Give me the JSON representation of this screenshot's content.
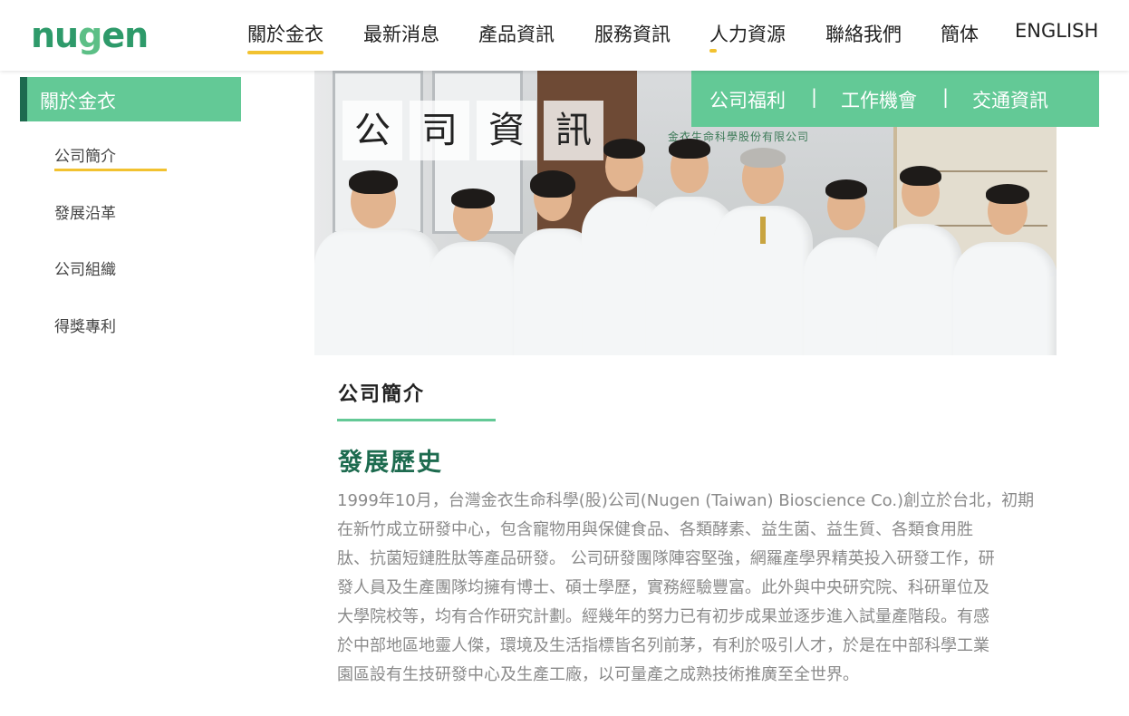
{
  "header": {
    "logo": {
      "part1": "nu",
      "part2": "g",
      "part3": "en"
    },
    "nav": [
      {
        "label": "關於金衣"
      },
      {
        "label": "最新消息"
      },
      {
        "label": "產品資訊"
      },
      {
        "label": "服務資訊"
      },
      {
        "label": "人力資源"
      },
      {
        "label": "聯絡我們"
      },
      {
        "label": "簡体"
      },
      {
        "label": "ENGLISH"
      }
    ]
  },
  "sidebar": {
    "heading": "關於金衣",
    "items": [
      {
        "label": "公司簡介"
      },
      {
        "label": "發展沿革"
      },
      {
        "label": "公司組織"
      },
      {
        "label": "得獎專利"
      }
    ]
  },
  "banner": {
    "title_chars": [
      "公",
      "司",
      "資",
      "訊"
    ],
    "wall_sign": "金衣生命科學股份有限公司"
  },
  "subnav": {
    "items": [
      {
        "label": "公司福利"
      },
      {
        "label": "工作機會"
      },
      {
        "label": "交通資訊"
      }
    ],
    "separator": "|"
  },
  "content": {
    "section_title": "公司簡介",
    "history_title": "發展歷史",
    "paragraph_lines": [
      "1999年10月，台灣金衣生命科學(股)公司(Nugen (Taiwan) Bioscience Co.)創立於台北，初期",
      "在新竹成立研發中心，包含寵物用與保健食品、各類酵素、益生菌、益生質、各類食用胜",
      "肽、抗菌短鏈胜肽等產品研發。 公司研發團隊陣容堅強，網羅產學界精英投入研發工作，研",
      "發人員及生產團隊均擁有博士、碩士學歷，實務經驗豐富。此外與中央研究院、科研單位及",
      "大學院校等，均有合作研究計劃。經幾年的努力已有初步成果並逐步進入試量產階段。有感",
      "於中部地區地靈人傑，環境及生活指標皆名列前茅，有利於吸引人才，於是在中部科學工業",
      "園區設有生技研發中心及生產工廠，以可量產之成熟技術推廣至全世界。"
    ]
  },
  "colors": {
    "brand_green": "#63c996",
    "dark_green": "#1d6b4f",
    "accent_yellow": "#f2c230"
  }
}
